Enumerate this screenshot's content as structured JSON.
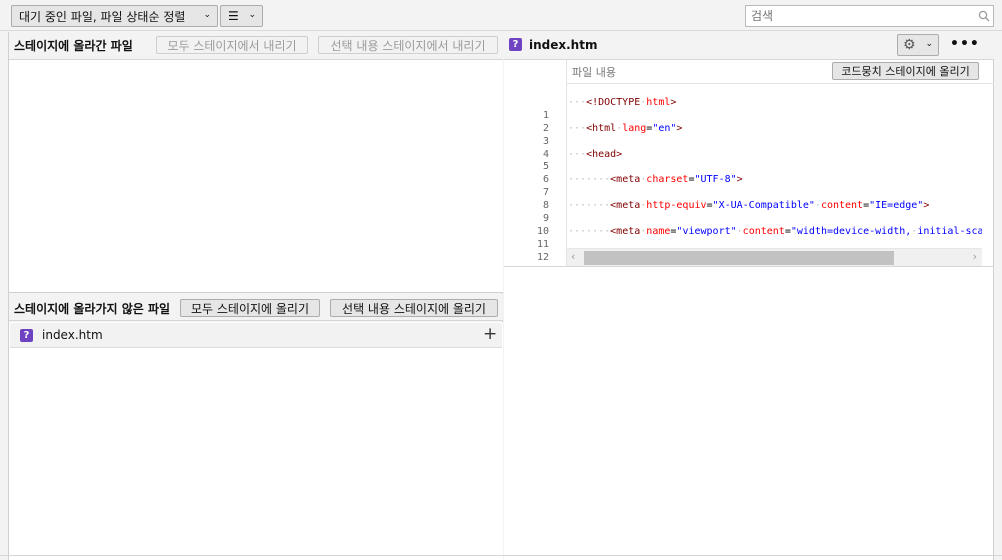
{
  "toolbar": {
    "sort_label": "대기 중인 파일, 파일 상태순 정렬",
    "search_placeholder": "검색"
  },
  "staged": {
    "title": "스테이지에 올라간 파일",
    "unstage_all": "모두 스테이지에서 내리기",
    "unstage_selected": "선택 내용 스테이지에서 내리기"
  },
  "unstaged": {
    "title": "스테이지에 올라가지 않은 파일",
    "stage_all": "모두 스테이지에 올리기",
    "stage_selected": "선택 내용 스테이지에 올리기",
    "files": [
      {
        "name": "index.htm",
        "status": "?"
      }
    ]
  },
  "diff": {
    "file_name": "index.htm",
    "status": "?",
    "content_label": "파일 내용",
    "stage_hunk": "코드뭉치 스테이지에 올리기",
    "line_numbers": [
      "1",
      "2",
      "3",
      "4",
      "5",
      "6",
      "7",
      "8",
      "9",
      "10",
      "11",
      "12"
    ]
  },
  "colors": {
    "untracked_icon": "#6f42c1"
  }
}
